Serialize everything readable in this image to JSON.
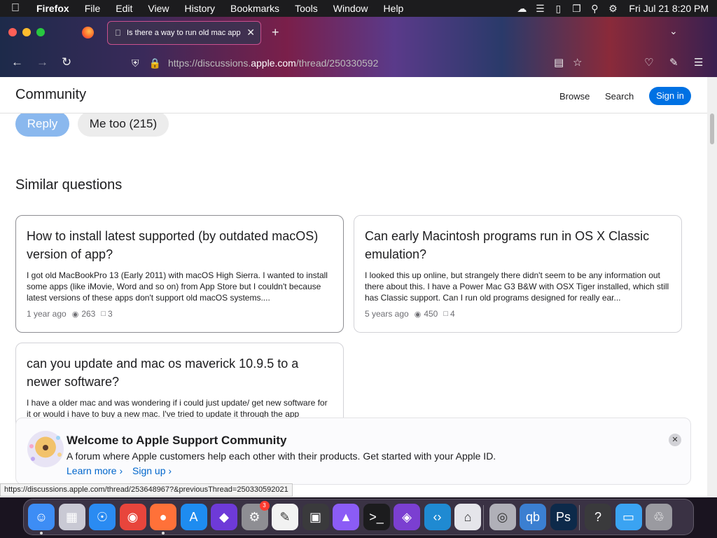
{
  "menubar": {
    "app_name": "Firefox",
    "items": [
      "File",
      "Edit",
      "View",
      "History",
      "Bookmarks",
      "Tools",
      "Window",
      "Help"
    ],
    "clock": "Fri Jul 21  8:20 PM"
  },
  "browser": {
    "tab_title": "Is there a way to run old mac app",
    "url_prefix": "https://discussions.",
    "url_domain": "apple.com",
    "url_path": "/thread/250330592"
  },
  "site": {
    "title": "Community",
    "nav": {
      "browse": "Browse",
      "search": "Search",
      "sign_in": "Sign in"
    }
  },
  "actions": {
    "reply": "Reply",
    "me_too": "Me too (215)"
  },
  "similar": {
    "heading": "Similar questions",
    "cards": [
      {
        "title": "How to install latest supported (by outdated macOS) version of app?",
        "body": "I got old MacBookPro 13 (Early 2011) with macOS High Sierra. I wanted to install some apps (like iMovie, Word and so on) from App Store but I couldn't because latest versions of these apps don't support old macOS systems....",
        "age": "1 year ago",
        "views": "263",
        "replies": "3"
      },
      {
        "title": "Can early Macintosh programs run in OS X Classic emulation?",
        "body": "I looked this up online, but strangely there didn't seem to be any information out there about this. I have a Power Mac G3 B&W with OSX Tiger installed, which still has Classic support. Can I run old programs designed for really ear...",
        "age": "5 years ago",
        "views": "450",
        "replies": "4"
      },
      {
        "title": "can you update and mac os maverick 10.9.5 to a newer software?",
        "body": "I have a older mac and was wondering if i could just update/ get new software for it or would i have to buy a new mac. I've tried to update it through the app",
        "age": "",
        "views": "",
        "replies": ""
      }
    ]
  },
  "welcome": {
    "title": "Welcome to Apple Support Community",
    "text": "A forum where Apple customers help each other with their products. Get started with your Apple ID.",
    "learn_more": "Learn more ›",
    "sign_up": "Sign up ›"
  },
  "status_url": "https://discussions.apple.com/thread/253648967?&previousThread=250330592021",
  "dock": {
    "settings_badge": "3",
    "items": [
      {
        "name": "finder",
        "glyph": "☺",
        "color": "#3d8df5"
      },
      {
        "name": "launchpad",
        "glyph": "▦",
        "color": "#c9c9d4"
      },
      {
        "name": "safari",
        "glyph": "☉",
        "color": "#2a8bf2"
      },
      {
        "name": "chrome",
        "glyph": "◉",
        "color": "#e8453c"
      },
      {
        "name": "firefox",
        "glyph": "●",
        "color": "#ff7139"
      },
      {
        "name": "app-store",
        "glyph": "A",
        "color": "#1e8cf0"
      },
      {
        "name": "shortcuts",
        "glyph": "◆",
        "color": "#6e3ad8"
      },
      {
        "name": "system-settings",
        "glyph": "⚙",
        "color": "#8e8e93"
      },
      {
        "name": "textedit",
        "glyph": "✎",
        "color": "#f2f2f2"
      },
      {
        "name": "screenshot",
        "glyph": "▣",
        "color": "#3a3a3c"
      },
      {
        "name": "automator",
        "glyph": "▲",
        "color": "#8b5cf6"
      },
      {
        "name": "terminal",
        "glyph": ">_",
        "color": "#1c1c1e"
      },
      {
        "name": "visual-studio",
        "glyph": "◈",
        "color": "#7b3fd1"
      },
      {
        "name": "vscode",
        "glyph": "‹›",
        "color": "#1f8ad2"
      },
      {
        "name": "library",
        "glyph": "⌂",
        "color": "#e5e5ea"
      },
      {
        "name": "disk-utility",
        "glyph": "◎",
        "color": "#b0b0b8"
      },
      {
        "name": "qbittorrent",
        "glyph": "qb",
        "color": "#3b7fd1"
      },
      {
        "name": "photoshop",
        "glyph": "Ps",
        "color": "#0d2a4a"
      },
      {
        "name": "help",
        "glyph": "?",
        "color": "#3a3a3c"
      },
      {
        "name": "downloads-folder",
        "glyph": "▭",
        "color": "#3aa3f2"
      },
      {
        "name": "trash",
        "glyph": "♲",
        "color": "#9a9aa0"
      }
    ]
  }
}
